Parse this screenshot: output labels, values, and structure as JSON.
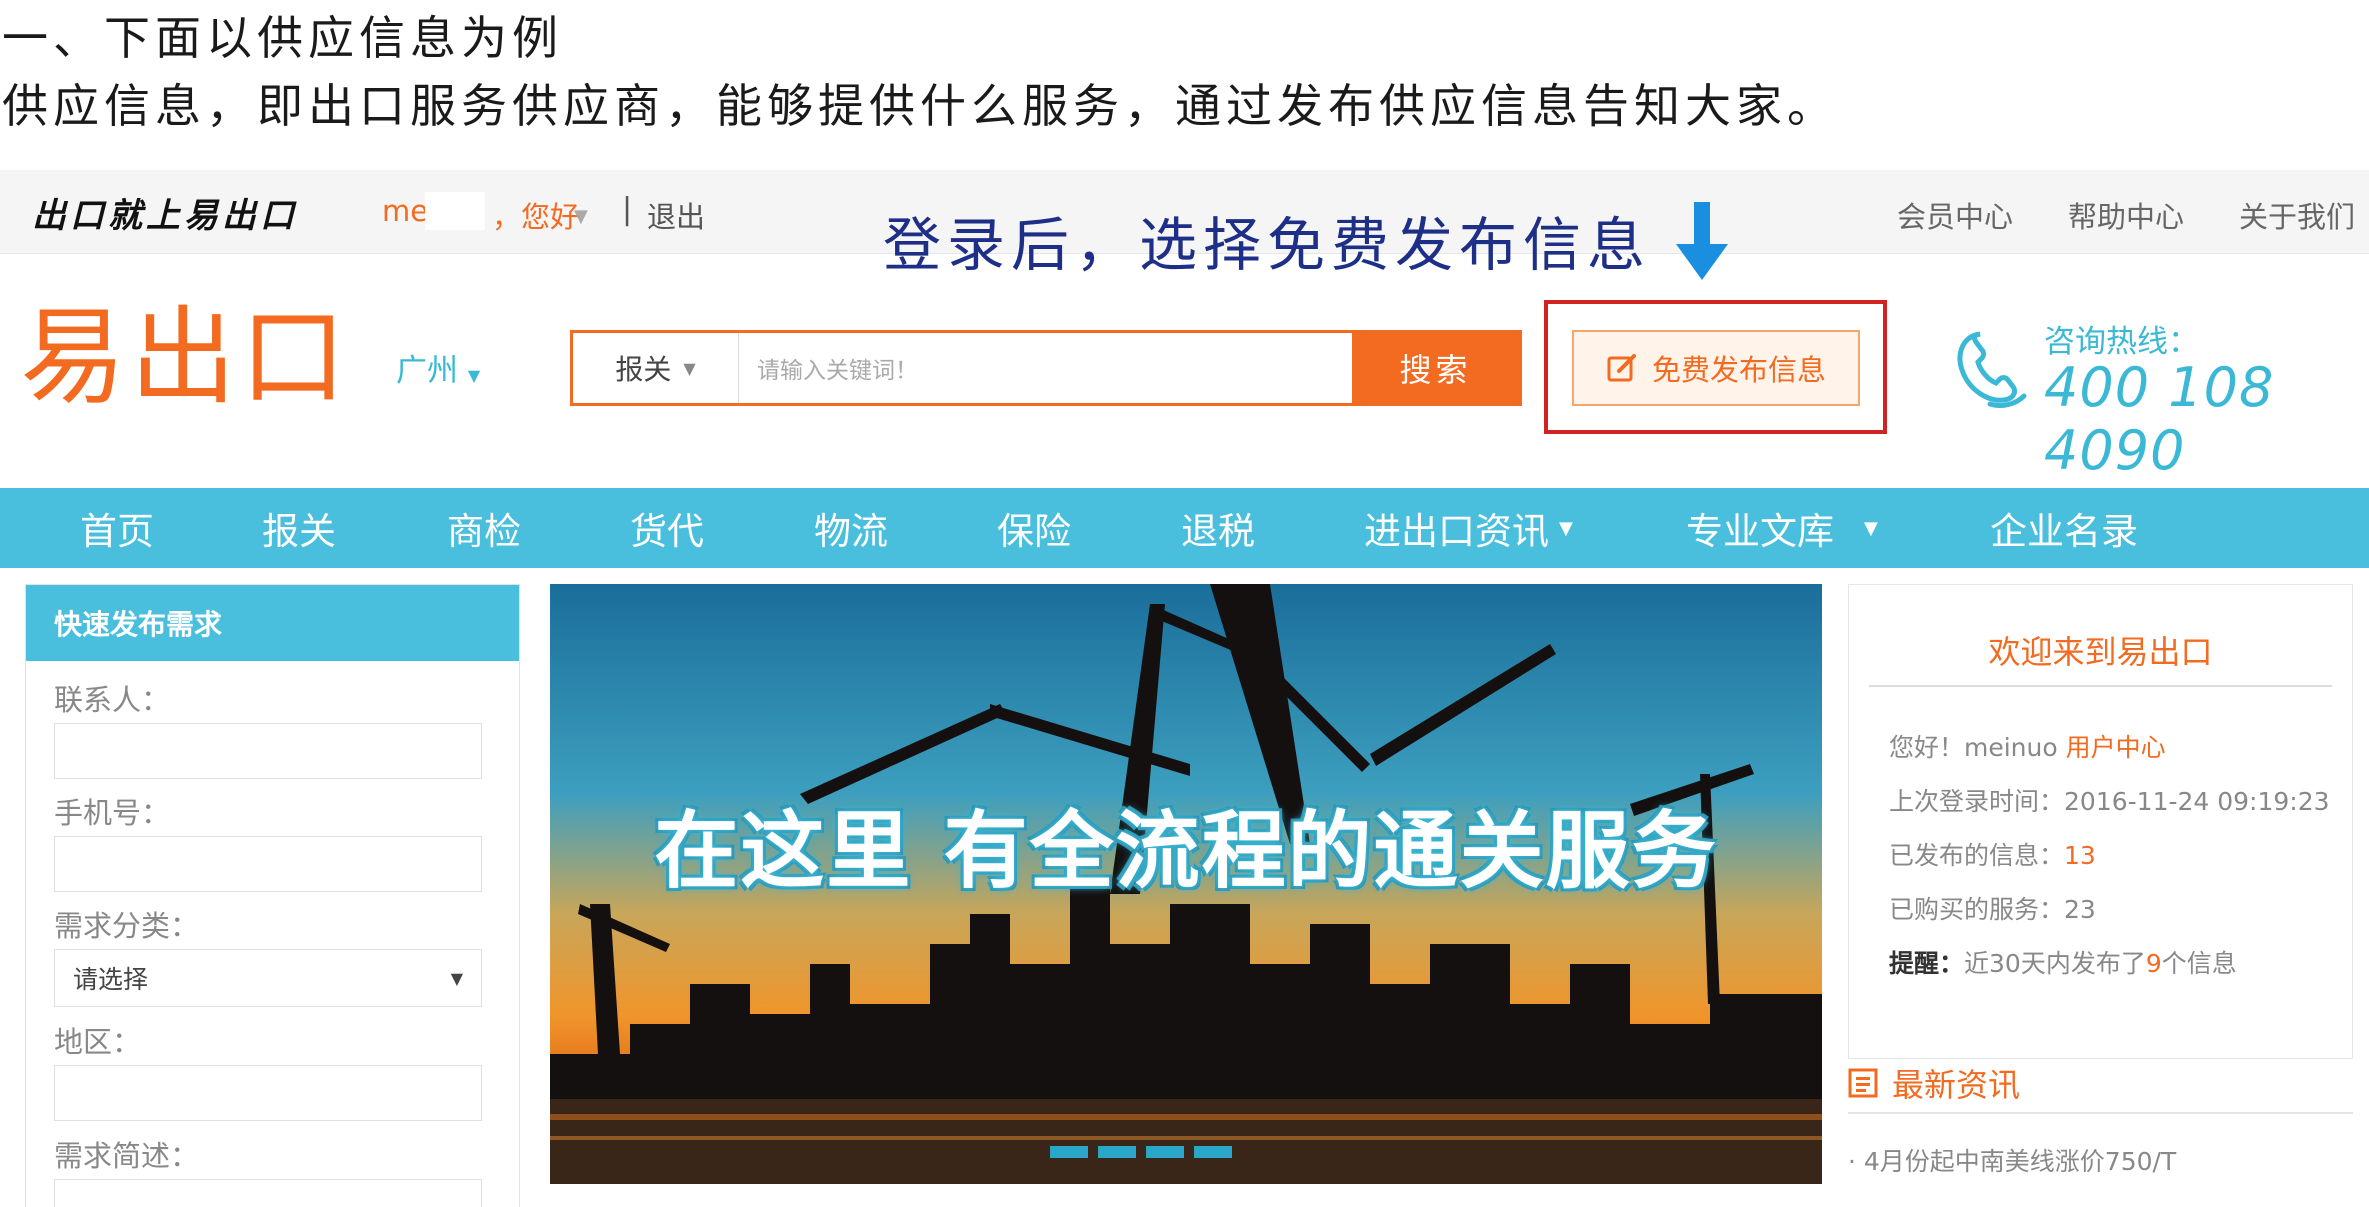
{
  "document": {
    "line1": "一、下面以供应信息为例",
    "line2": "供应信息，即出口服务供应商，能够提供什么服务，通过发布供应信息告知大家。"
  },
  "annotation": {
    "text": "登录后，选择免费发布信息",
    "color": "#1d2f86",
    "arrow_icon": "down-arrow-icon"
  },
  "topbar": {
    "slogan": "出口就上易出口",
    "user_name": "me",
    "user_greeting": "，您好",
    "separator": "|",
    "logout": "退出",
    "links": [
      "会员中心",
      "帮助中心",
      "关于我们"
    ]
  },
  "header": {
    "logo": "易出口",
    "city": "广州",
    "search": {
      "category": "报关",
      "placeholder": "请输入关键词！",
      "button": "搜索"
    },
    "publish_button": "免费发布信息",
    "hotline_label": "咨询热线：",
    "hotline_number": "400 108 4090"
  },
  "nav": {
    "items": [
      "首页",
      "报关",
      "商检",
      "货代",
      "物流",
      "保险",
      "退税",
      "进出口资讯",
      "专业文库",
      "企业名录"
    ]
  },
  "quick_form": {
    "title": "快速发布需求",
    "contact_label": "联系人：",
    "phone_label": "手机号：",
    "category_label": "需求分类：",
    "category_value": "请选择",
    "region_label": "地区：",
    "desc_label": "需求简述："
  },
  "banner": {
    "text": "在这里 有全流程的通关服务",
    "slide_count": 4
  },
  "welcome": {
    "title": "欢迎来到易出口",
    "greeting": "您好！meinuo ",
    "user_center": "用户中心",
    "last_login_label": "上次登录时间：",
    "last_login_value": "2016-11-24 09:19:23",
    "published_label": "已发布的信息：",
    "published_count": "13",
    "purchased_label": "已购买的服务：",
    "purchased_count": "23",
    "reminder_label": "提醒：",
    "reminder_prefix": "近30天内发布了",
    "reminder_count": "9",
    "reminder_suffix": "个信息"
  },
  "news": {
    "title": "最新资讯",
    "items": [
      "· 4月份起中南美线涨价750/T"
    ]
  },
  "colors": {
    "brand_orange": "#f26b21",
    "brand_blue": "#49bfdd",
    "highlight_red": "#d22222"
  }
}
